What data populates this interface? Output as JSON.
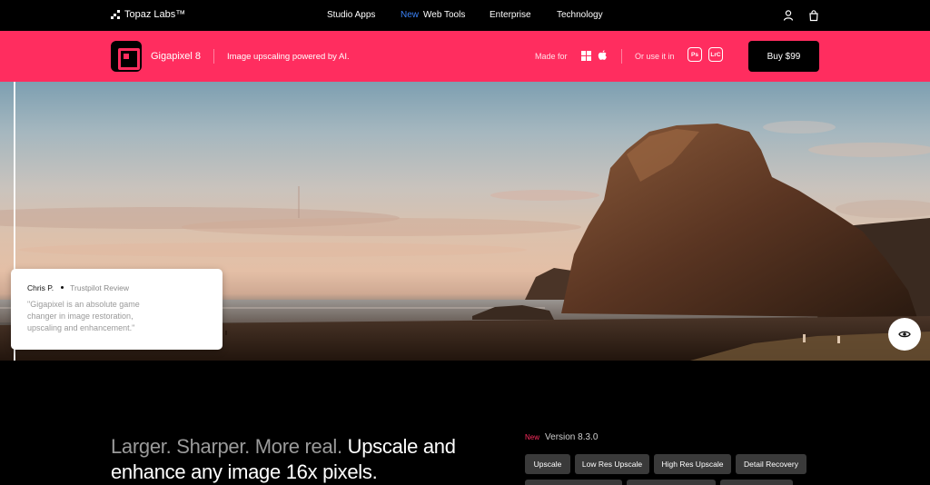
{
  "nav": {
    "brand": "Topaz Labs™",
    "links": [
      {
        "label": "Studio Apps",
        "badge": ""
      },
      {
        "label": "Web Tools",
        "badge": "New"
      },
      {
        "label": "Enterprise",
        "badge": ""
      },
      {
        "label": "Technology",
        "badge": ""
      }
    ],
    "icons": [
      "user-icon",
      "shopping-bag-icon"
    ]
  },
  "product": {
    "name": "Gigapixel 8",
    "tagline": "Image upscaling powered by AI.",
    "made_for_label": "Made for",
    "platforms": [
      "windows-icon",
      "apple-icon"
    ],
    "use_in_label": "Or use it in",
    "plugins": [
      "Ps",
      "LrC"
    ],
    "buy_label": "Buy  $99",
    "accent_color": "#ff2d5f"
  },
  "review": {
    "author": "Chris P.",
    "source": "Trustpilot Review",
    "quote": "\"Gigapixel is an absolute game changer in image restoration, upscaling and enhancement.\""
  },
  "hero": {
    "compare_icon": "eye-icon"
  },
  "section": {
    "headline_muted": "Larger. Sharper. More real.",
    "headline_main": "Upscale and enhance any image 16x pixels.",
    "version_badge": "New",
    "version_text": "Version 8.3.0",
    "chips": [
      "Upscale",
      "Low Res Upscale",
      "High Res Upscale",
      "Detail Recovery"
    ]
  }
}
